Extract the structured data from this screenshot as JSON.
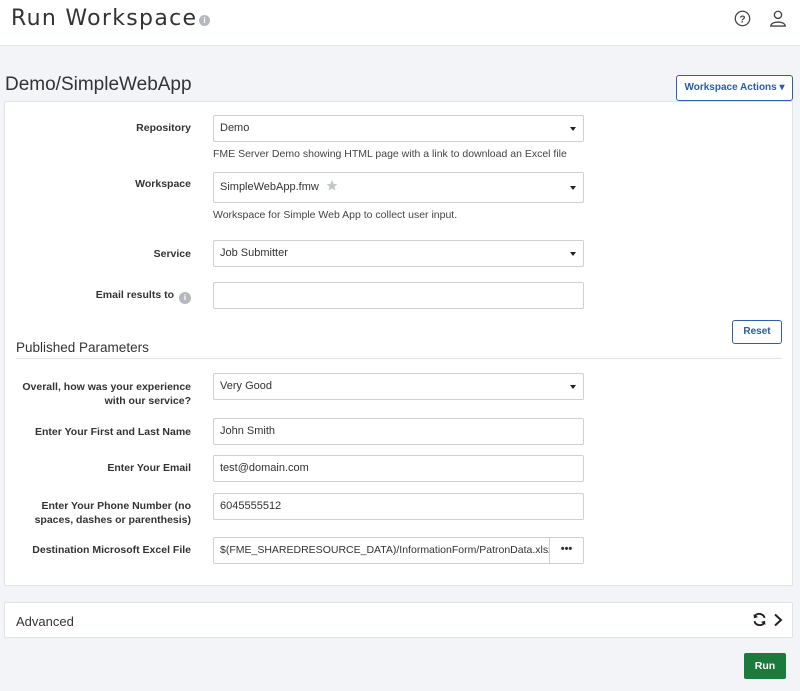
{
  "header": {
    "title": "Run Workspace",
    "info_icon": "info-icon",
    "help_icon": "help-circle-icon",
    "user_icon": "user-icon"
  },
  "page": {
    "heading": "Demo/SimpleWebApp",
    "workspace_actions_label": "Workspace Actions ▾"
  },
  "form": {
    "repository": {
      "label": "Repository",
      "value": "Demo",
      "help": "FME Server Demo showing HTML page with a link to download an Excel file"
    },
    "workspace": {
      "label": "Workspace",
      "value": "SimpleWebApp.fmw",
      "help": "Workspace for Simple Web App to collect user input."
    },
    "service": {
      "label": "Service",
      "value": "Job Submitter"
    },
    "email": {
      "label": "Email results to",
      "value": ""
    },
    "reset_label": "Reset"
  },
  "published": {
    "title": "Published Parameters",
    "experience": {
      "label_line1": "Overall, how was your experience",
      "label_line2": "with our service?",
      "value": "Very Good"
    },
    "name": {
      "label": "Enter Your First and Last Name",
      "value": "John Smith"
    },
    "email": {
      "label": "Enter Your Email",
      "value": "test@domain.com"
    },
    "phone": {
      "label_line1": "Enter Your Phone Number (no",
      "label_line2": "spaces, dashes or parenthesis)",
      "value": "6045555512"
    },
    "excel": {
      "label": "Destination Microsoft Excel File",
      "value": "$(FME_SHAREDRESOURCE_DATA)/InformationForm/PatronData.xlsx",
      "browse_label": "•••"
    }
  },
  "advanced": {
    "label": "Advanced"
  },
  "actions": {
    "run_label": "Run"
  },
  "colors": {
    "accent": "#2b5ca6",
    "run": "#1b7a3c"
  }
}
